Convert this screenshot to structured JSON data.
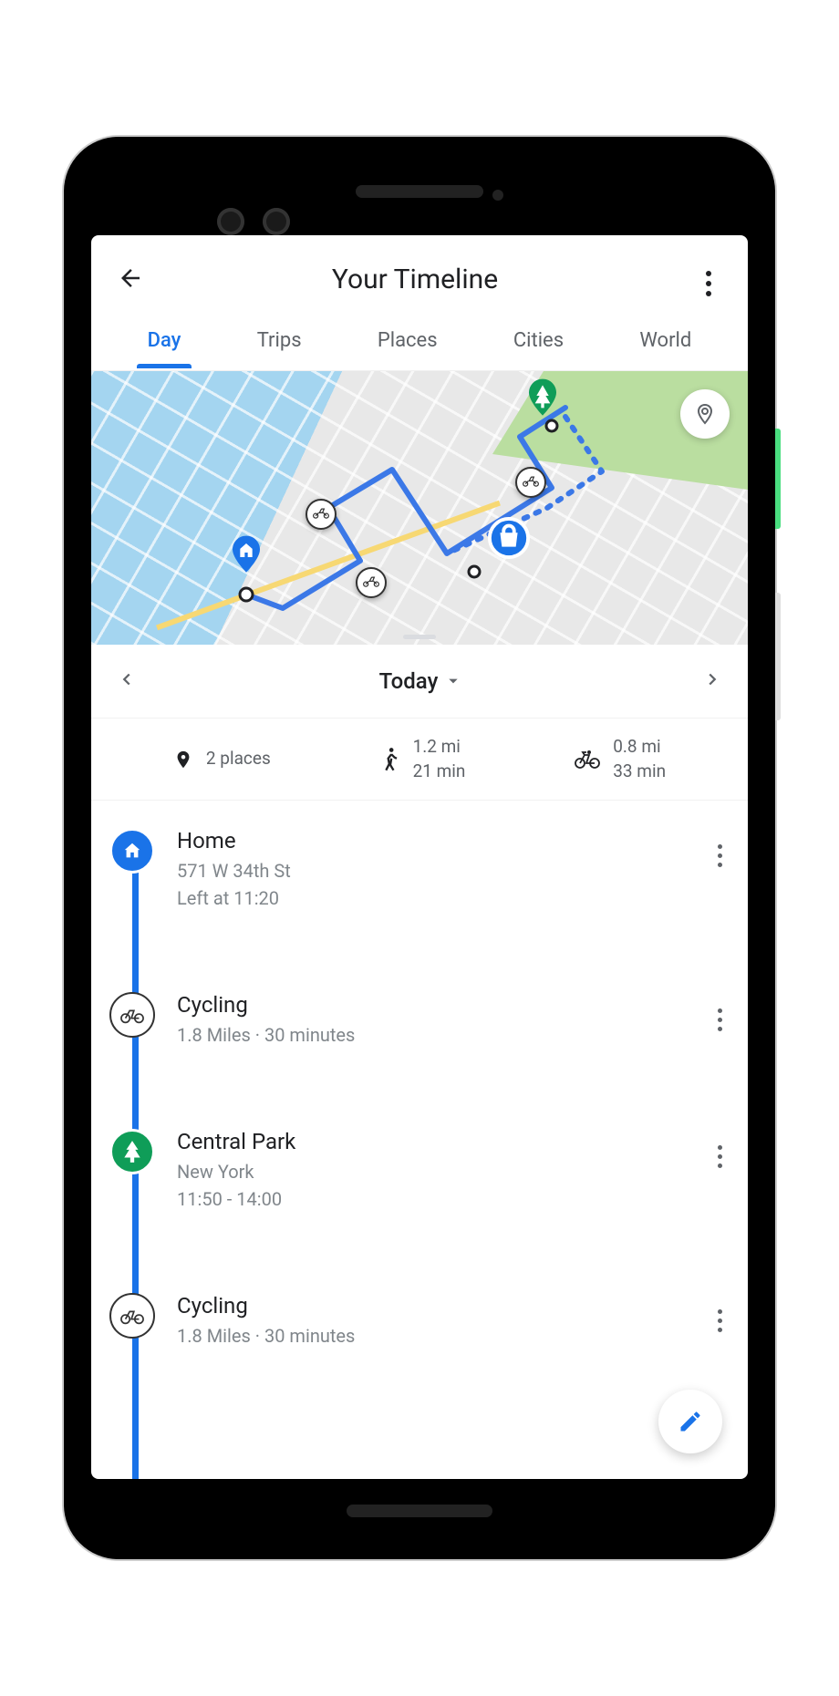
{
  "header": {
    "title": "Your Timeline"
  },
  "tabs": [
    {
      "label": "Day",
      "active": true
    },
    {
      "label": "Trips",
      "active": false
    },
    {
      "label": "Places",
      "active": false
    },
    {
      "label": "Cities",
      "active": false
    },
    {
      "label": "World",
      "active": false
    }
  ],
  "dateNav": {
    "label": "Today"
  },
  "summary": {
    "places": "2 places",
    "walk_dist": "1.2 mi",
    "walk_time": "21 min",
    "bike_dist": "0.8 mi",
    "bike_time": "33 min"
  },
  "timeline": [
    {
      "icon": "home",
      "iconStyle": "blue",
      "title": "Home",
      "line1": "571 W 34th St",
      "line2": "Left at 11:20"
    },
    {
      "icon": "bike",
      "iconStyle": "white",
      "title": "Cycling",
      "line1": "1.8 Miles · 30 minutes",
      "line2": ""
    },
    {
      "icon": "tree",
      "iconStyle": "green",
      "title": "Central Park",
      "line1": "New York",
      "line2": "11:50 - 14:00"
    },
    {
      "icon": "bike",
      "iconStyle": "white",
      "title": "Cycling",
      "line1": "1.8 Miles · 30 minutes",
      "line2": ""
    }
  ],
  "colors": {
    "primary": "#1a73e8",
    "green": "#0f9d58",
    "text": "#202124",
    "muted": "#5f6368"
  }
}
